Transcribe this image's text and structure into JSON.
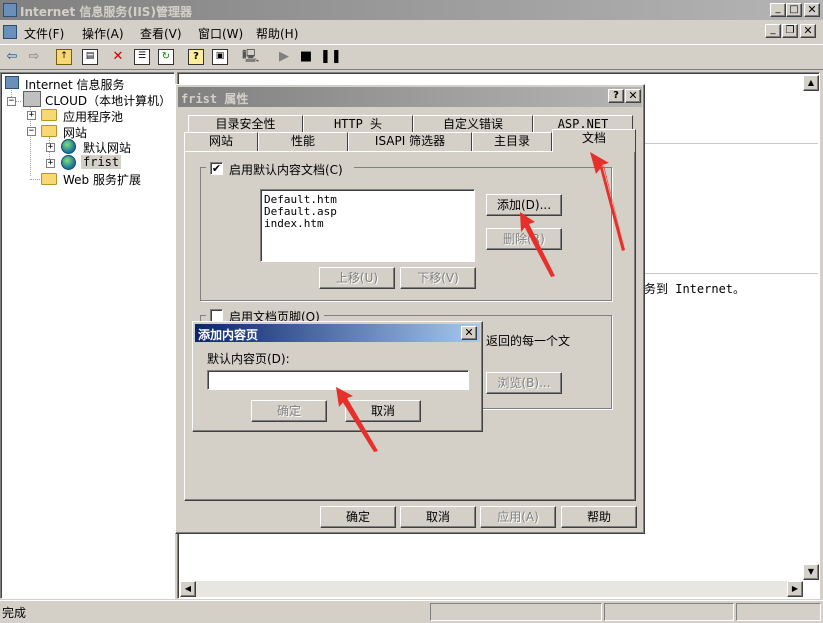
{
  "window": {
    "title": "Internet 信息服务(IIS)管理器"
  },
  "menu": [
    "文件(F)",
    "操作(A)",
    "查看(V)",
    "窗口(W)",
    "帮助(H)"
  ],
  "tree": {
    "root": "Internet 信息服务",
    "computer": "CLOUD（本地计算机）",
    "app_pools": "应用程序池",
    "websites": "网站",
    "default_site": "默认网站",
    "frist": "frist",
    "web_ext": "Web 服务扩展"
  },
  "right_pane": {
    "text_fragment": "务到 Internet。"
  },
  "statusbar": {
    "text": "完成"
  },
  "props": {
    "title": "frist 属性",
    "tabs_back": [
      "目录安全性",
      "HTTP 头",
      "自定义错误",
      "ASP.NET"
    ],
    "tabs_front": [
      "网站",
      "性能",
      "ISAPI 筛选器",
      "主目录",
      "文档"
    ],
    "enable_default_doc": "启用默认内容文档(C)",
    "docs": [
      "Default.htm",
      "Default.asp",
      "index.htm"
    ],
    "add_btn": "添加(D)...",
    "remove_btn": "删除(R)",
    "up_btn": "上移(U)",
    "down_btn": "下移(V)",
    "enable_footer": "启用文档页脚(O)",
    "footer_text_fragment": "返回的每一个文",
    "browse_btn": "浏览(B)...",
    "ok": "确定",
    "cancel": "取消",
    "apply": "应用(A)",
    "help": "帮助"
  },
  "add_dialog": {
    "title": "添加内容页",
    "label": "默认内容页(D):",
    "input_value": "",
    "ok": "确定",
    "cancel": "取消"
  },
  "annotation_color": "#e8302a"
}
